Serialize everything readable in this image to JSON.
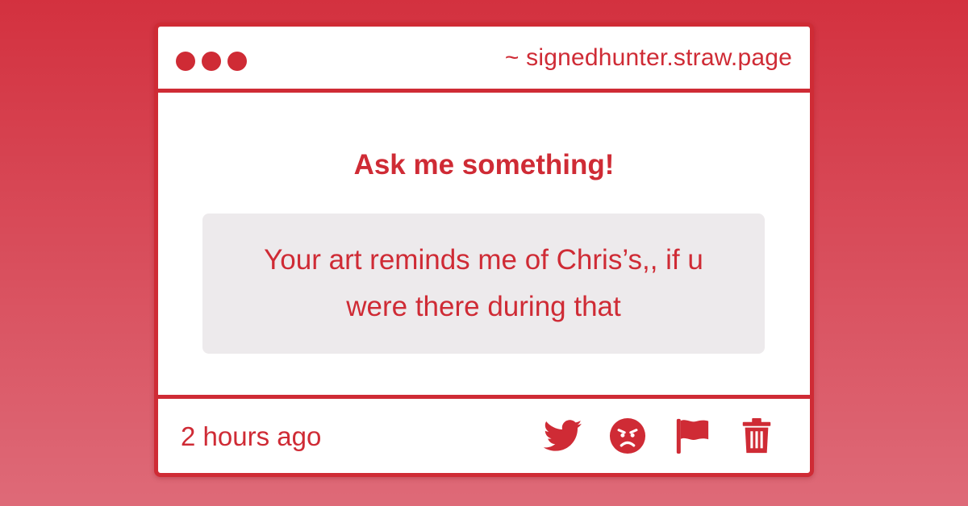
{
  "window": {
    "url": "~ signedhunter.straw.page"
  },
  "main": {
    "heading": "Ask me something!",
    "question": "Your art reminds me of Chris’s,, if u were there during that"
  },
  "footer": {
    "timestamp": "2 hours ago",
    "actions": [
      {
        "icon": "twitter-icon"
      },
      {
        "icon": "angry-face-icon"
      },
      {
        "icon": "flag-icon"
      },
      {
        "icon": "trash-icon"
      }
    ]
  },
  "colors": {
    "accent": "#cf2b35",
    "background_top": "#d3313f",
    "background_bottom": "#de6a78",
    "question_box": "#edeaec"
  }
}
